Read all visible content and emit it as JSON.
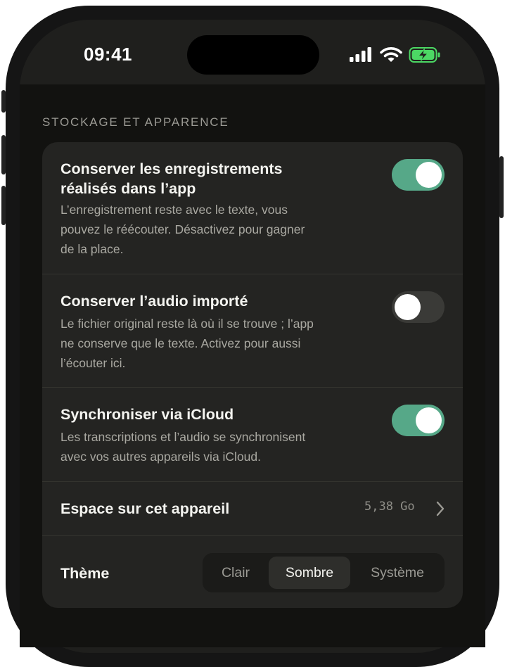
{
  "status_bar": {
    "time": "09:41",
    "icons": [
      "signal-bars-icon",
      "wifi-icon",
      "battery-charging-icon"
    ]
  },
  "section": {
    "title": "STOCKAGE ET APPARENCE"
  },
  "settings": [
    {
      "title_line1": "Conserver les enregistrements",
      "title_line2": "réalisés dans l’app",
      "desc_line1": "L’enregistrement reste avec le texte, vous",
      "desc_line2": "pouvez le réécouter. Désactivez pour gagner",
      "desc_line3": "de la place.",
      "enabled": true
    },
    {
      "title_line1": "Conserver l’audio importé",
      "desc_line1": "Le fichier original reste là où il se trouve ; l’app",
      "desc_line2": "ne conserve que le texte. Activez pour aussi",
      "desc_line3": "l’écouter ici.",
      "enabled": false
    },
    {
      "title_line1": "Synchroniser via iCloud",
      "desc_line1": "Les transcriptions et l’audio se synchronisent",
      "desc_line2": "avec vos autres appareils via iCloud.",
      "enabled": true
    }
  ],
  "storage": {
    "label": "Espace sur cet appareil",
    "value": "5,38 Go"
  },
  "theme": {
    "label": "Thème",
    "options": [
      "Clair",
      "Sombre",
      "Système"
    ],
    "selected": "Sombre"
  },
  "colors": {
    "accent_toggle_on": "#56a888",
    "battery_green": "#4cd964",
    "background": "#121210",
    "card": "#242422"
  }
}
